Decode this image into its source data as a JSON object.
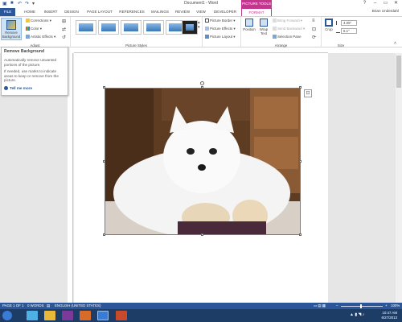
{
  "window": {
    "title": "Document1 - Word"
  },
  "context_tab_group": "PICTURE TOOLS",
  "tabs": [
    "FILE",
    "HOME",
    "INSERT",
    "DESIGN",
    "PAGE LAYOUT",
    "REFERENCES",
    "MAILINGS",
    "REVIEW",
    "VIEW",
    "DEVELOPER",
    "FORMAT"
  ],
  "user": "Brian Underdahl",
  "ribbon": {
    "remove_background": "Remove Background",
    "adjust": {
      "corrections": "Corrections",
      "color": "Color",
      "artistic_effects": "Artistic Effects",
      "label": "Adjust"
    },
    "picture_styles_label": "Picture Styles",
    "picture_border": "Picture Border",
    "picture_effects": "Picture Effects",
    "picture_layout": "Picture Layout",
    "position": "Position",
    "wrap_text": "Wrap Text",
    "bring_forward": "Bring Forward",
    "send_backward": "Send Backward",
    "selection_pane": "Selection Pane",
    "arrange_label": "Arrange",
    "crop": "Crop",
    "height": "4.05\"",
    "width": "6.1\"",
    "size_label": "Size"
  },
  "tooltip": {
    "title": "Remove Background",
    "line1": "Automatically remove unwanted portions of the picture.",
    "line2": "If needed, use marks to indicate areas to keep or remove from the picture.",
    "more": "Tell me more"
  },
  "status": {
    "page": "PAGE 1 OF 1",
    "words": "0 WORDS",
    "language": "ENGLISH (UNITED STATES)",
    "zoom": "100%"
  },
  "clock": {
    "time": "10:47 AM",
    "date": "6/27/2013"
  },
  "colors": {
    "word_blue": "#2b579a",
    "format_magenta": "#c0378d"
  }
}
